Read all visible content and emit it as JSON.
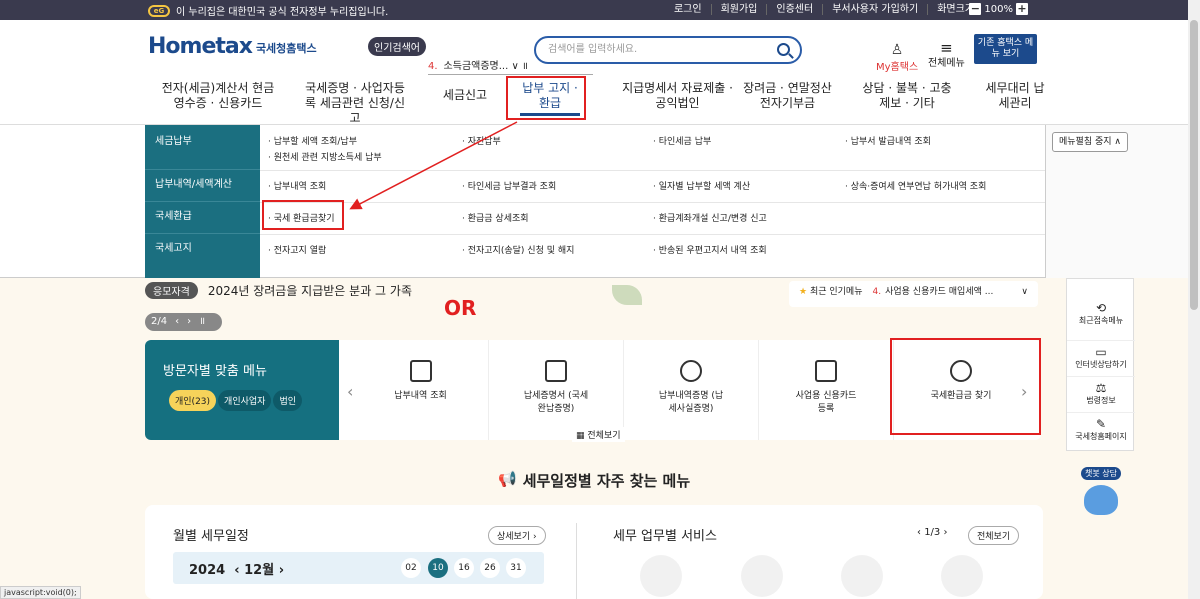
{
  "topbar": {
    "gov_notice": "이 누리집은 대한민국 공식 전자정부 누리집입니다.",
    "links": [
      "로그인",
      "회원가입",
      "인증센터",
      "부서사용자 가입하기",
      "화면크기"
    ],
    "zoom": "100%"
  },
  "header": {
    "logo": "Hometax",
    "logo_kr": "국세청홈택스",
    "popular_tag": "인기검색어",
    "popular_rank": "4.",
    "popular_value": "소득금액증명...",
    "search_placeholder": "검색어를 입력하세요.",
    "my_hometax": "My홈택스",
    "all_menu": "전체메뉴",
    "old_menu": "기존 홈택스 메뉴 보기"
  },
  "gnb": [
    "전자(세금)계산서 현금영수증 · 신용카드",
    "국세증명 · 사업자등록 세금관련 신청/신고",
    "세금신고",
    "납부 고지 · 환급",
    "지급명세서 자료제출 · 공익법인",
    "장려금 · 연말정산 전자기부금",
    "상담 · 불복 · 고충 제보 · 기타",
    "세무대리 납세관리"
  ],
  "dropdown": {
    "collapse": "메뉴펼침 중지",
    "rows": [
      {
        "title": "세금납부",
        "items": [
          "· 납부할 세액 조회/납부",
          "· 자진납부",
          "· 타인세금 납부",
          "· 납부서 발급내역 조회",
          "· 원천세 관련 지방소득세 납부"
        ]
      },
      {
        "title": "납부내역/세액계산",
        "items": [
          "· 납부내역 조회",
          "· 타인세금 납부결과 조회",
          "· 일자별 납부할 세액 계산",
          "· 상속·증여세 연부연납 허가내역 조회"
        ]
      },
      {
        "title": "국세환급",
        "items": [
          "· 국세 환급금찾기",
          "· 환급금 상세조회",
          "· 환급계좌개설 신고/변경 신고"
        ]
      },
      {
        "title": "국세고지",
        "items": [
          "· 전자고지 열람",
          "· 전자고지(송달) 신청 및 해지",
          "· 반송된 우편고지서 내역 조회"
        ]
      }
    ]
  },
  "promo": {
    "tag": "응모자격",
    "text": "2024년 장려금을 지급받은 분과 그 가족"
  },
  "or_label": "OR",
  "pager": {
    "count": "2/4"
  },
  "hot": {
    "label": "최근 인기메뉴",
    "rank": "4.",
    "value": "사업용 신용카드 매입세액 ..."
  },
  "visitor": {
    "title": "방문자별 맞춤 메뉴",
    "tabs": [
      "개인(23)",
      "개인사업자",
      "법인"
    ],
    "menus": [
      "납부내역 조회",
      "납세증명서 (국세완납증명)",
      "납부내역증명 (납세사실증명)",
      "사업용 신용카드 등록",
      "국세환급금 찾기"
    ],
    "full": "전체보기"
  },
  "sidebar": [
    "최근접속메뉴",
    "인터넷상담하기",
    "법령정보",
    "국세청홈페이지"
  ],
  "chatbot": "챗봇 상담",
  "section_title": "세무일정별 자주 찾는 메뉴",
  "monthly": {
    "title": "월별 세무일정",
    "detail": "상세보기",
    "year": "2024",
    "month": "12월",
    "days": [
      "02",
      "10",
      "16",
      "26",
      "31"
    ]
  },
  "service": {
    "title": "세무 업무별 서비스",
    "page": "1/3",
    "all": "전체보기"
  },
  "statusbar": "javascript:void(0);",
  "colors": {
    "accent": "#1c4a8c",
    "teal": "#1b6f80",
    "annotation": "#e12020"
  }
}
